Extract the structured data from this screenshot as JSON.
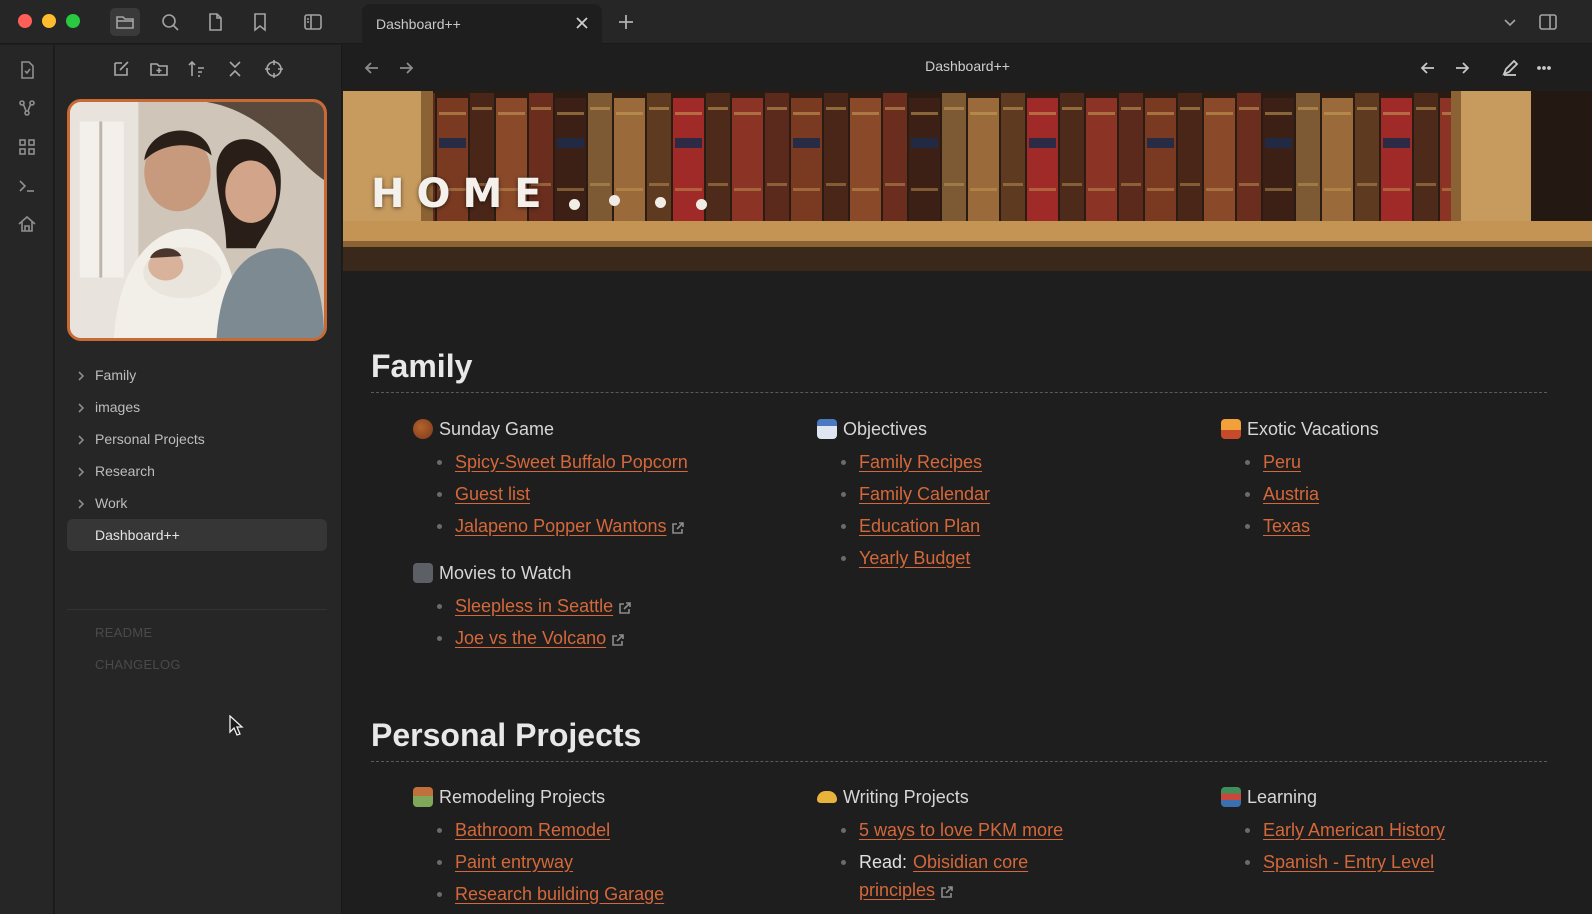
{
  "window": {
    "tab_title": "Dashboard++",
    "view_title": "Dashboard++"
  },
  "titlebar_icons": [
    "folder-icon",
    "search-icon",
    "file-icon",
    "bookmark-icon",
    "sidebar-toggle-icon"
  ],
  "ribbon_icons": [
    "open-file-icon",
    "graph-icon",
    "grid-icon",
    "terminal-icon",
    "home-icon"
  ],
  "sidebar": {
    "tools": [
      "new-note-icon",
      "new-folder-icon",
      "sort-icon",
      "collapse-icon",
      "locate-icon"
    ],
    "tree": [
      {
        "label": "Family",
        "folder": true
      },
      {
        "label": "images",
        "folder": true
      },
      {
        "label": "Personal Projects",
        "folder": true
      },
      {
        "label": "Research",
        "folder": true
      },
      {
        "label": "Work",
        "folder": true
      },
      {
        "label": "Dashboard++",
        "folder": false,
        "active": true
      }
    ],
    "faded": [
      "README",
      "CHANGELOG"
    ]
  },
  "banner": {
    "title": "HOME"
  },
  "sections": {
    "family": {
      "heading": "Family",
      "sunday_game": {
        "title": "Sunday Game",
        "links": [
          "Spicy-Sweet Buffalo Popcorn",
          "Guest list",
          "Jalapeno Popper Wantons"
        ]
      },
      "movies": {
        "title": "Movies to Watch",
        "links": [
          "Sleepless in Seattle",
          "Joe vs the Volcano"
        ]
      },
      "objectives": {
        "title": "Objectives",
        "links": [
          "Family Recipes",
          "Family Calendar",
          "Education Plan",
          "Yearly Budget"
        ]
      },
      "vacations": {
        "title": "Exotic Vacations",
        "links": [
          "Peru",
          "Austria",
          "Texas"
        ]
      }
    },
    "personal": {
      "heading": "Personal Projects",
      "remodeling": {
        "title": "Remodeling Projects",
        "links": [
          "Bathroom Remodel",
          "Paint entryway",
          "Research building Garage"
        ]
      },
      "writing": {
        "title": "Writing Projects",
        "link1": "5 ways to love PKM more",
        "read_prefix": "Read:",
        "read_link_a": "Obisidian core",
        "read_link_b": "principles"
      },
      "learning": {
        "title": "Learning",
        "links": [
          "Early American History",
          "Spanish - Entry Level"
        ]
      }
    }
  },
  "colors": {
    "link": "#d5683a",
    "accent_border": "#c96a35",
    "background": "#1e1e1e",
    "sidebar": "#262626"
  }
}
